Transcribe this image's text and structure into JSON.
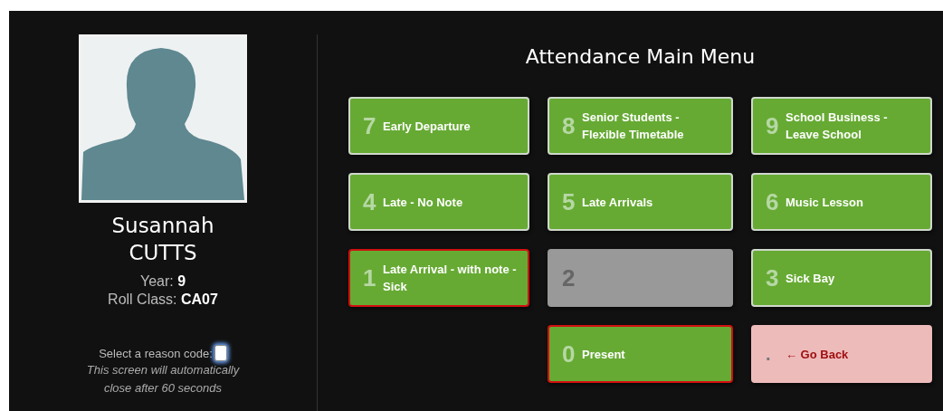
{
  "student": {
    "first_name": "Susannah",
    "last_name": "CUTTS",
    "year_label": "Year:",
    "year": "9",
    "class_label": "Roll Class:",
    "roll_class": "CA07"
  },
  "reason_prompt": {
    "label": "Select a reason code:",
    "focused": true
  },
  "notice": "This screen will automatically close after 60 seconds",
  "menu": {
    "title": "Attendance Main Menu",
    "rows": [
      [
        {
          "kind": "code",
          "key": "7",
          "label": "Early Departure",
          "highlighted": false
        },
        {
          "kind": "code",
          "key": "8",
          "label": "Senior Students - Flexible Timetable",
          "highlighted": false
        },
        {
          "kind": "code",
          "key": "9",
          "label": "School Business - Leave School",
          "highlighted": false
        }
      ],
      [
        {
          "kind": "code",
          "key": "4",
          "label": "Late - No Note",
          "highlighted": false
        },
        {
          "kind": "code",
          "key": "5",
          "label": "Late Arrivals",
          "highlighted": false
        },
        {
          "kind": "code",
          "key": "6",
          "label": "Music Lesson",
          "highlighted": false
        }
      ],
      [
        {
          "kind": "code",
          "key": "1",
          "label": "Late Arrival - with note - Sick",
          "highlighted": true
        },
        {
          "kind": "disabled",
          "key": "2",
          "highlighted": false
        },
        {
          "kind": "code",
          "key": "3",
          "label": "Sick Bay",
          "highlighted": false
        }
      ],
      [
        "",
        {
          "kind": "code",
          "key": "0",
          "label": "Present",
          "highlighted": true
        },
        {
          "kind": "back",
          "key": ".",
          "label": "← Go Back",
          "highlighted": false
        }
      ]
    ]
  }
}
